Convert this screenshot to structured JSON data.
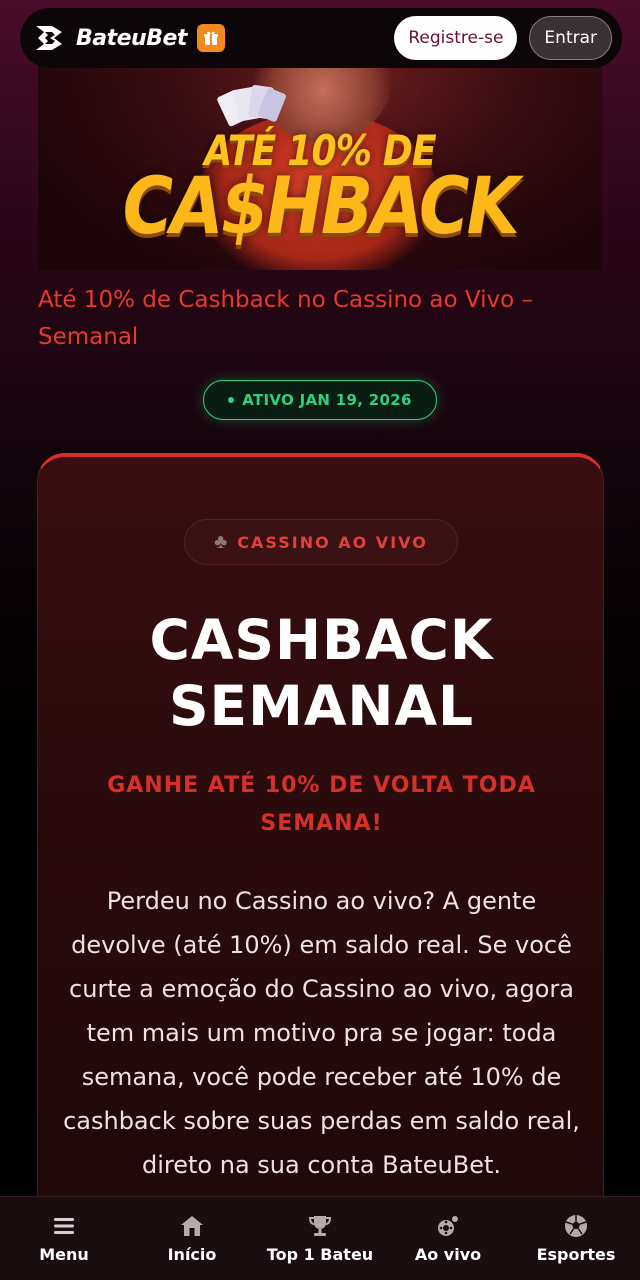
{
  "header": {
    "brand": "BateuBet",
    "register_label": "Registre-se",
    "login_label": "Entrar"
  },
  "banner": {
    "line1": "ATÉ 10% DE",
    "line2": "CA$HBACK"
  },
  "promo": {
    "title": "Até 10% de Cashback no Cassino ao Vivo – Semanal",
    "status": "ATIVO JAN 19, 2026"
  },
  "card": {
    "category": "CASSINO AO VIVO",
    "heading": "CASHBACK SEMANAL",
    "subheading": "GANHE ATÉ 10% DE VOLTA TODA SEMANA!",
    "body": "Perdeu no Cassino ao vivo? A gente devolve (até 10%) em saldo real. Se você curte a emoção do Cassino ao vivo, agora tem mais um motivo pra se jogar: toda semana, você pode receber até 10% de cashback sobre suas perdas em saldo real, direto na sua conta BateuBet."
  },
  "bottom_nav": {
    "items": [
      {
        "label": "Menu",
        "icon": "menu-icon"
      },
      {
        "label": "Início",
        "icon": "home-icon"
      },
      {
        "label": "Top 1 Bateu",
        "icon": "trophy-icon"
      },
      {
        "label": "Ao vivo",
        "icon": "roulette-icon"
      },
      {
        "label": "Esportes",
        "icon": "soccer-ball-icon"
      }
    ]
  },
  "colors": {
    "accent_red": "#e63a2e",
    "status_green": "#2fd079",
    "gift_orange": "#f08a1c",
    "banner_gold": "#ffc21f"
  }
}
